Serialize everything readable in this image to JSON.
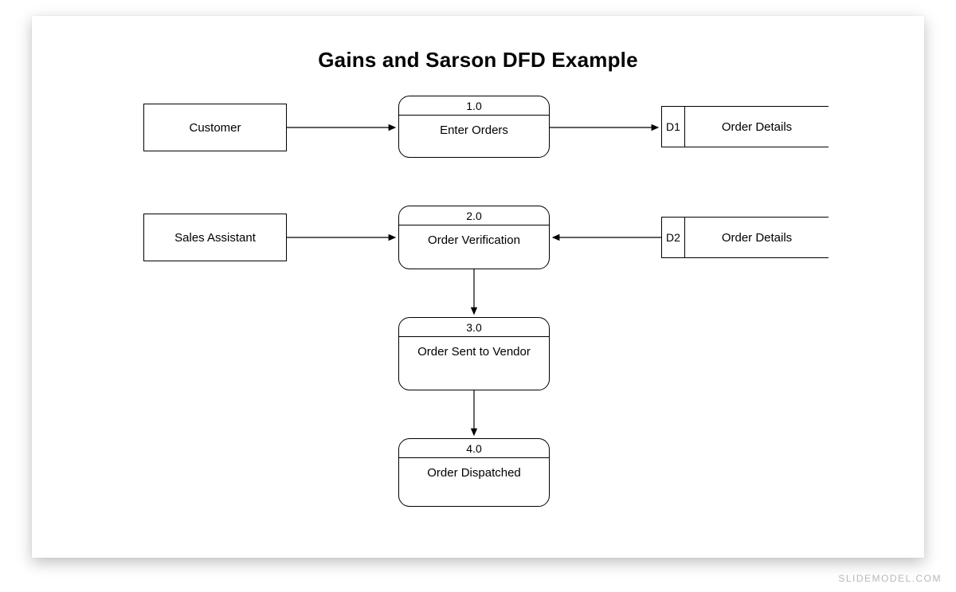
{
  "title": "Gains and Sarson DFD Example",
  "entities": {
    "customer": "Customer",
    "sales_assistant": "Sales Assistant"
  },
  "processes": {
    "p1": {
      "num": "1.0",
      "label": "Enter Orders"
    },
    "p2": {
      "num": "2.0",
      "label": "Order Verification"
    },
    "p3": {
      "num": "3.0",
      "label": "Order Sent to Vendor"
    },
    "p4": {
      "num": "4.0",
      "label": "Order Dispatched"
    }
  },
  "datastores": {
    "d1": {
      "num": "D1",
      "label": "Order Details"
    },
    "d2": {
      "num": "D2",
      "label": "Order Details"
    }
  },
  "watermark": "SLIDEMODEL.COM"
}
